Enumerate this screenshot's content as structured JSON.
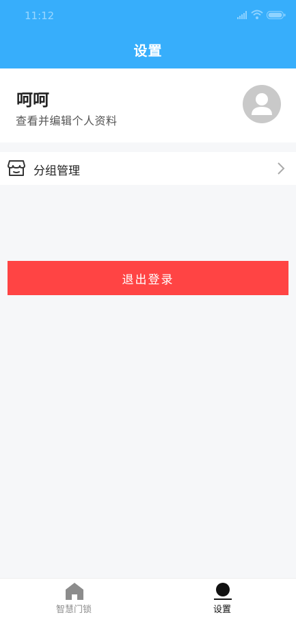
{
  "status_bar": {
    "time": "11:12",
    "icons": [
      "signal-icon",
      "wifi-icon",
      "battery-icon"
    ]
  },
  "header": {
    "title": "设置"
  },
  "profile": {
    "name": "呵呵",
    "subtitle": "查看并编辑个人资料",
    "avatar_icon": "user-avatar-icon"
  },
  "menu": [
    {
      "label": "分组管理",
      "icon": "store-icon"
    }
  ],
  "logout": {
    "label": "退出登录"
  },
  "tab_bar": {
    "tabs": [
      {
        "label": "智慧门锁",
        "icon": "home-icon",
        "active": false
      },
      {
        "label": "设置",
        "icon": "person-icon",
        "active": true
      }
    ]
  },
  "colors": {
    "header_blue": "#37aefb",
    "logout_red": "#ff4444",
    "background": "#f6f7f9",
    "inactive_tab": "#8c8c8c"
  }
}
